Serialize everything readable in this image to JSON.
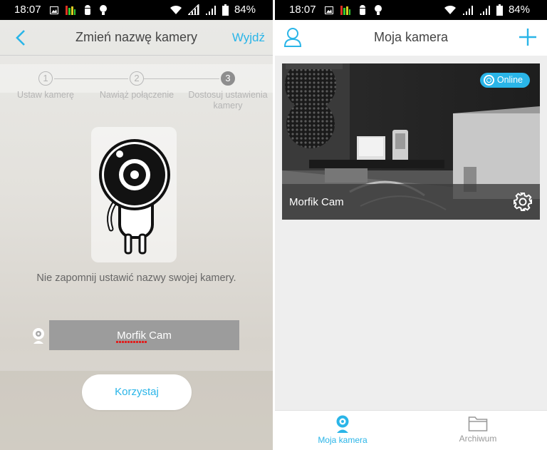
{
  "status_bar": {
    "left_time": "18:07",
    "left_battery": "84%",
    "right_time": "18:07",
    "right_battery": "84%"
  },
  "left_screen": {
    "title": "Zmień nazwę kamery",
    "exit_label": "Wyjdź",
    "steps": [
      {
        "number": "1",
        "label": "Ustaw kamerę"
      },
      {
        "number": "2",
        "label": "Nawiąż połączenie"
      },
      {
        "number": "3",
        "label": "Dostosuj ustawienia kamery"
      }
    ],
    "hint": "Nie zapomnij ustawić nazwy swojej kamery.",
    "camera_name_value": "Morfik Cam",
    "use_button": "Korzystaj"
  },
  "right_screen": {
    "title": "Moja kamera",
    "camera_card": {
      "status": "Online",
      "name": "Morfik Cam"
    },
    "nav": [
      {
        "label": "Moja kamera",
        "icon": "camera-icon",
        "active": true
      },
      {
        "label": "Archiwum",
        "icon": "folder-icon",
        "active": false
      }
    ]
  },
  "colors": {
    "accent": "#2ab5e8",
    "status_bar": "#000000",
    "online_badge": "#2ab5e8"
  }
}
